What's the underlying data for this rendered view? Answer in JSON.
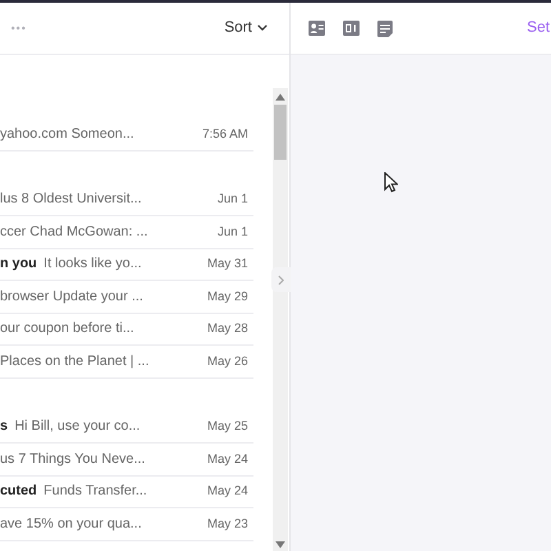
{
  "toolbar": {
    "more": "•••",
    "sort": "Sort"
  },
  "groups": [
    {
      "messages": [
        {
          "preview": "yahoo.com Someon...",
          "time": "7:56 AM",
          "unread": false
        }
      ]
    },
    {
      "messages": [
        {
          "preview": "lus 8 Oldest Universit...",
          "time": "Jun 1",
          "unread": false
        },
        {
          "preview": "ccer Chad McGowan: ...",
          "time": "Jun 1",
          "unread": false
        },
        {
          "sender": "n you",
          "preview": "It looks like yo...",
          "time": "May 31",
          "unread": true
        },
        {
          "preview": "browser Update your ...",
          "time": "May 29",
          "unread": false
        },
        {
          "preview": "our coupon before ti...",
          "time": "May 28",
          "unread": false
        },
        {
          "preview": "Places on the Planet | ...",
          "time": "May 26",
          "unread": false
        }
      ]
    },
    {
      "messages": [
        {
          "sender": "s",
          "preview": "Hi Bill, use your co...",
          "time": "May 25",
          "unread": true
        },
        {
          "preview": "us 7 Things You Neve...",
          "time": "May 24",
          "unread": false
        },
        {
          "sender": "cuted",
          "preview": "Funds Transfer...",
          "time": "May 24",
          "unread": true
        },
        {
          "preview": "ave 15% on your qua...",
          "time": "May 23",
          "unread": false
        }
      ]
    }
  ],
  "reading_pane": {
    "settings_link": "Set"
  }
}
